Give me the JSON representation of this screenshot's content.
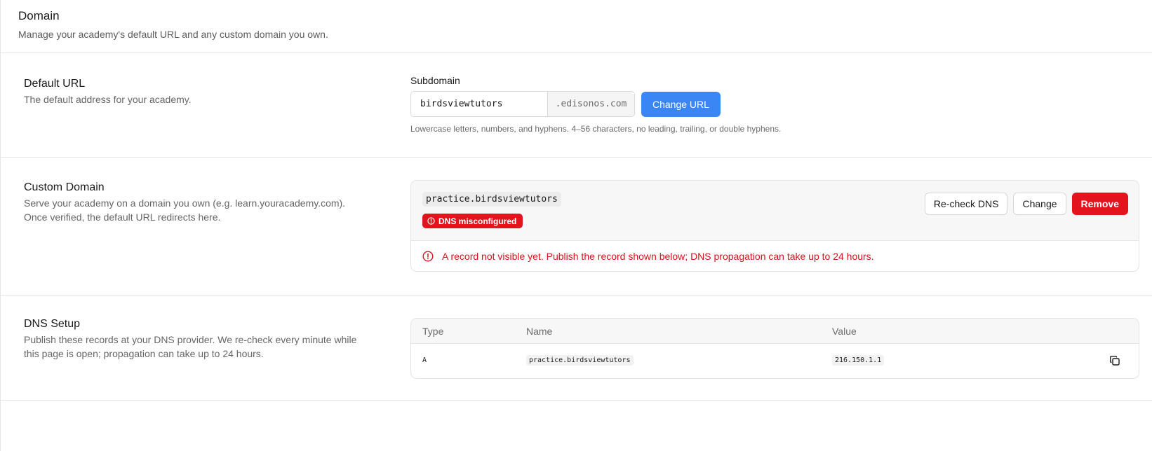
{
  "header": {
    "title": "Domain",
    "subtitle": "Manage your academy's default URL and any custom domain you own."
  },
  "default_url": {
    "title": "Default URL",
    "description": "The default address for your academy.",
    "subdomain_label": "Subdomain",
    "subdomain_value": "birdsviewtutors",
    "suffix": ".edisonos.com",
    "change_button": "Change URL",
    "hint": "Lowercase letters, numbers, and hyphens. 4–56 characters, no leading, trailing, or double hyphens."
  },
  "custom_domain": {
    "title": "Custom Domain",
    "description_line1": "Serve your academy on a domain you own (e.g. learn.youracademy.com).",
    "description_line2": "Once verified, the default URL redirects here.",
    "domain": "practice.birdsviewtutors",
    "status_badge": "DNS misconfigured",
    "recheck_button": "Re-check DNS",
    "change_button": "Change",
    "remove_button": "Remove",
    "error_message": "A record not visible yet. Publish the record shown below; DNS propagation can take up to 24 hours.",
    "colors": {
      "error": "#e3141e",
      "primary": "#3a86f5"
    }
  },
  "dns_setup": {
    "title": "DNS Setup",
    "description_line1": "Publish these records at your DNS provider. We re-check every minute while",
    "description_line2": "this page is open; propagation can take up to 24 hours.",
    "columns": [
      "Type",
      "Name",
      "Value"
    ],
    "rows": [
      {
        "type": "A",
        "name": "practice.birdsviewtutors",
        "value": "216.150.1.1",
        "action_icon": "copy-icon"
      }
    ]
  }
}
